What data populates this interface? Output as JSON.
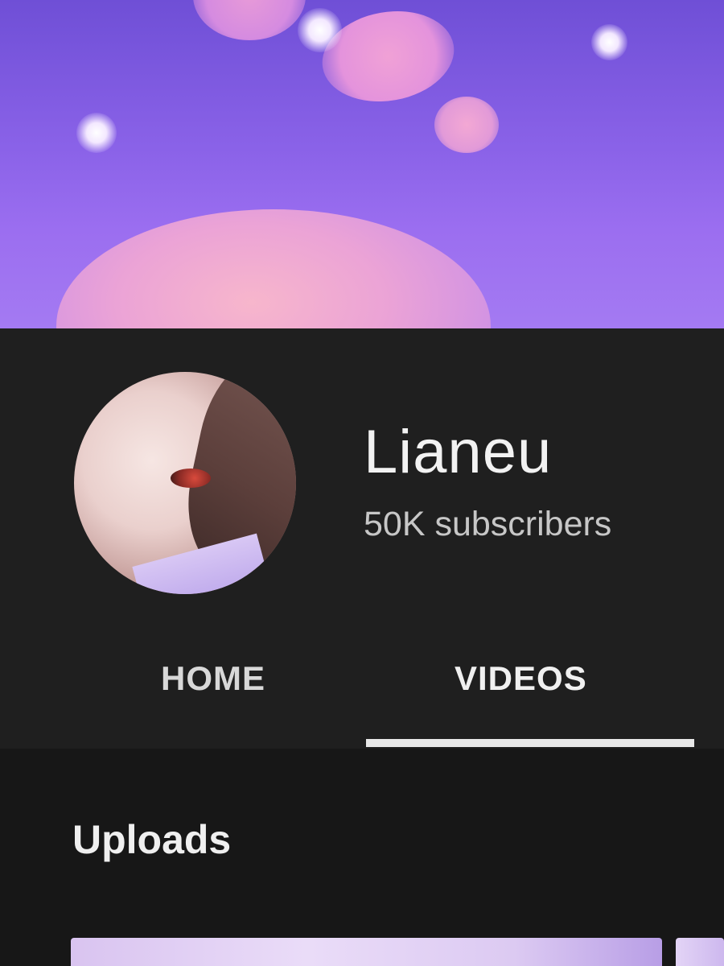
{
  "channel": {
    "name": "Lianeu",
    "subscribers": "50K subscribers"
  },
  "tabs": [
    {
      "label": "HOME",
      "selected": false
    },
    {
      "label": "VIDEOS",
      "selected": true
    }
  ],
  "section": {
    "title": "Uploads"
  },
  "colors": {
    "banner": "#8a62e8",
    "background": "#1f1f1f",
    "text": "#f2f2f2",
    "subtext": "#c7c7c7",
    "tab_indicator": "#e8e8e8"
  }
}
